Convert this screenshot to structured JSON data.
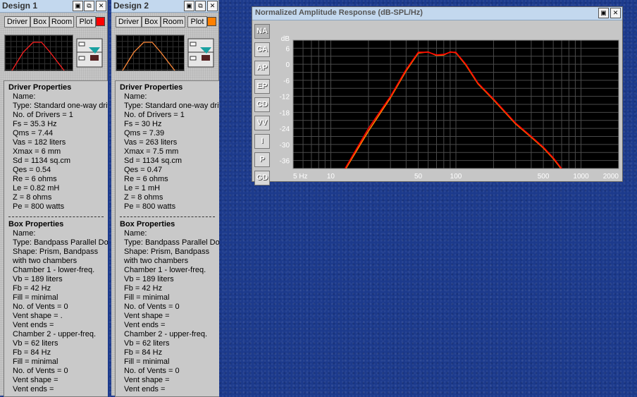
{
  "designs": [
    {
      "title": "Design 1",
      "swatch": "#ff0000",
      "tabs": [
        "Driver",
        "Box",
        "Room",
        "Plot"
      ],
      "driver_header": "Driver Properties",
      "driver_lines": [
        "Name:",
        "Type: Standard one-way driv",
        "No. of Drivers = 1",
        "Fs =  35.3 Hz",
        "Qms =  7.44",
        "Vas =  182 liters",
        "Xmax =  6 mm",
        "Sd =  1134 sq.cm",
        "Qes =  0.54",
        "Re =  6 ohms",
        "Le =  0.82 mH",
        "Z =  8 ohms",
        "Pe =  800 watts"
      ],
      "box_header": "Box Properties",
      "box_lines": [
        "Name:",
        "Type: Bandpass Parallel Dou",
        "Shape: Prism, Bandpass",
        "  with two chambers",
        "Chamber 1 - lower-freq.",
        "  Vb =  189 liters",
        "  Fb =  42 Hz",
        "  Fill = minimal",
        "  No. of Vents = 0",
        "    Vent shape = .",
        "    Vent ends =",
        "Chamber 2 - upper-freq.",
        "  Vb =  62 liters",
        "  Fb =  84 Hz",
        "  Fill = minimal",
        "  No. of Vents = 0",
        "    Vent shape =",
        "    Vent ends ="
      ]
    },
    {
      "title": "Design 2",
      "swatch": "#ff8000",
      "tabs": [
        "Driver",
        "Box",
        "Room",
        "Plot"
      ],
      "driver_header": "Driver Properties",
      "driver_lines": [
        "Name:",
        "Type: Standard one-way driv",
        "No. of Drivers = 1",
        "Fs =  30 Hz",
        "Qms =  7.39",
        "Vas =  263 liters",
        "Xmax =  7.5 mm",
        "Sd =  1134 sq.cm",
        "Qes =  0.47",
        "Re =  6 ohms",
        "Le =  1 mH",
        "Z =  8 ohms",
        "Pe =  800 watts"
      ],
      "box_header": "Box Properties",
      "box_lines": [
        "Name:",
        "Type: Bandpass Parallel Dou",
        "Shape: Prism, Bandpass",
        "  with two chambers",
        "Chamber 1 - lower-freq.",
        "  Vb =  189 liters",
        "  Fb =  42 Hz",
        "  Fill = minimal",
        "  No. of Vents = 0",
        "    Vent shape =",
        "    Vent ends =",
        "Chamber 2 - upper-freq.",
        "  Vb =  62 liters",
        "  Fb =  84 Hz",
        "  Fill = minimal",
        "  No. of Vents = 0",
        "    Vent shape =",
        "    Vent ends ="
      ]
    }
  ],
  "window_buttons": [
    "▣",
    "⧉",
    "✕"
  ],
  "chart_window": {
    "title": "Normalized Amplitude Response (dB-SPL/Hz)",
    "sidebar": [
      "NA",
      "CA",
      "AP",
      "EP",
      "CD",
      "VV",
      "I",
      "P",
      "GD"
    ],
    "active": "NA"
  },
  "chart_data": {
    "type": "line",
    "xscale": "log",
    "xlim": [
      5,
      2000
    ],
    "ylim": [
      -39,
      9
    ],
    "ylabel": "dB",
    "grid": true,
    "x_tick_labels": [
      "5 Hz",
      "10",
      "50",
      "100",
      "500",
      "1000",
      "2000"
    ],
    "x_tick_values": [
      5,
      10,
      50,
      100,
      500,
      1000,
      2000
    ],
    "y_tick_values": [
      6,
      0,
      -6,
      -12,
      -18,
      -24,
      -30,
      -36
    ],
    "series": [
      {
        "color": "#ff0000",
        "x": [
          13,
          20,
          30,
          40,
          50,
          60,
          70,
          80,
          90,
          100,
          120,
          150,
          200,
          300,
          400,
          500,
          600,
          700
        ],
        "y": [
          -39,
          -24,
          -12,
          -2,
          4.5,
          4.5,
          3.5,
          3.7,
          4.5,
          4.5,
          0,
          -7,
          -13,
          -22,
          -27,
          -31,
          -35,
          -39
        ]
      },
      {
        "color": "#ff8000",
        "x": [
          13,
          20,
          30,
          40,
          50,
          60,
          70,
          80,
          90,
          100,
          120,
          150,
          200,
          300,
          400,
          500,
          600,
          700
        ],
        "y": [
          -39.5,
          -25,
          -12.5,
          -2.5,
          4.2,
          4.6,
          3.3,
          3.5,
          4.6,
          4.3,
          -0.3,
          -7.3,
          -13.3,
          -22.3,
          -27.3,
          -31.3,
          -35.3,
          -39.3
        ]
      }
    ]
  }
}
